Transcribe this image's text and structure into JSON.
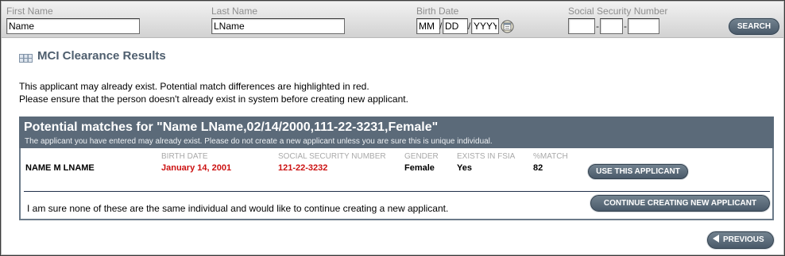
{
  "search": {
    "first_name": {
      "label": "First Name",
      "value": "Name"
    },
    "last_name": {
      "label": "Last Name",
      "value": "LName"
    },
    "birth_date": {
      "label": "Birth Date",
      "mm": "MM",
      "dd": "DD",
      "yyyy": "YYYY",
      "separator": "/",
      "icon": "calendar-icon"
    },
    "ssn": {
      "label": "Social Security Number",
      "separator": "-"
    },
    "search_button": "SEARCH"
  },
  "section": {
    "title": "MCI Clearance Results",
    "icon": "grid-icon"
  },
  "notice": {
    "line1": "This applicant may already exist. Potential match differences are highlighted in red.",
    "line2": "Please ensure that the person doesn't already exist in system before creating new applicant."
  },
  "matches": {
    "title": "Potential matches for \"Name LName,02/14/2000,111-22-3231,Female\"",
    "subtitle": "The applicant you have entered may already exist. Please do not create a new applicant unless you are sure this is unique individual.",
    "columns": [
      {
        "key": "birth_date",
        "label": "BIRTH DATE"
      },
      {
        "key": "ssn",
        "label": "SOCIAL SECURITY NUMBER"
      },
      {
        "key": "gender",
        "label": "GENDER"
      },
      {
        "key": "exists_in_fsia",
        "label": "EXISTS IN FSIA"
      },
      {
        "key": "match",
        "label": "%MATCH"
      }
    ],
    "rows": [
      {
        "name": "NAME M LNAME",
        "birth_date": "January 14, 2001",
        "ssn": "121-22-3232",
        "gender": "Female",
        "exists_in_fsia": "Yes",
        "match": "82",
        "differences": [
          "birth_date",
          "ssn"
        ],
        "action_label": "USE THIS APPLICANT"
      }
    ],
    "continue_text": "I am sure none of these are the same individual and would like to continue creating a new applicant.",
    "continue_button": "CONTINUE CREATING NEW APPLICANT"
  },
  "previous_button": {
    "label": "PREVIOUS",
    "icon": "arrow-left-icon"
  },
  "colors": {
    "panel_header": "#5b6a79",
    "panel_border": "#6b7a89",
    "highlight": "#cc1111",
    "section_title": "#4e5e6e",
    "divider": "#1f2e4a"
  }
}
